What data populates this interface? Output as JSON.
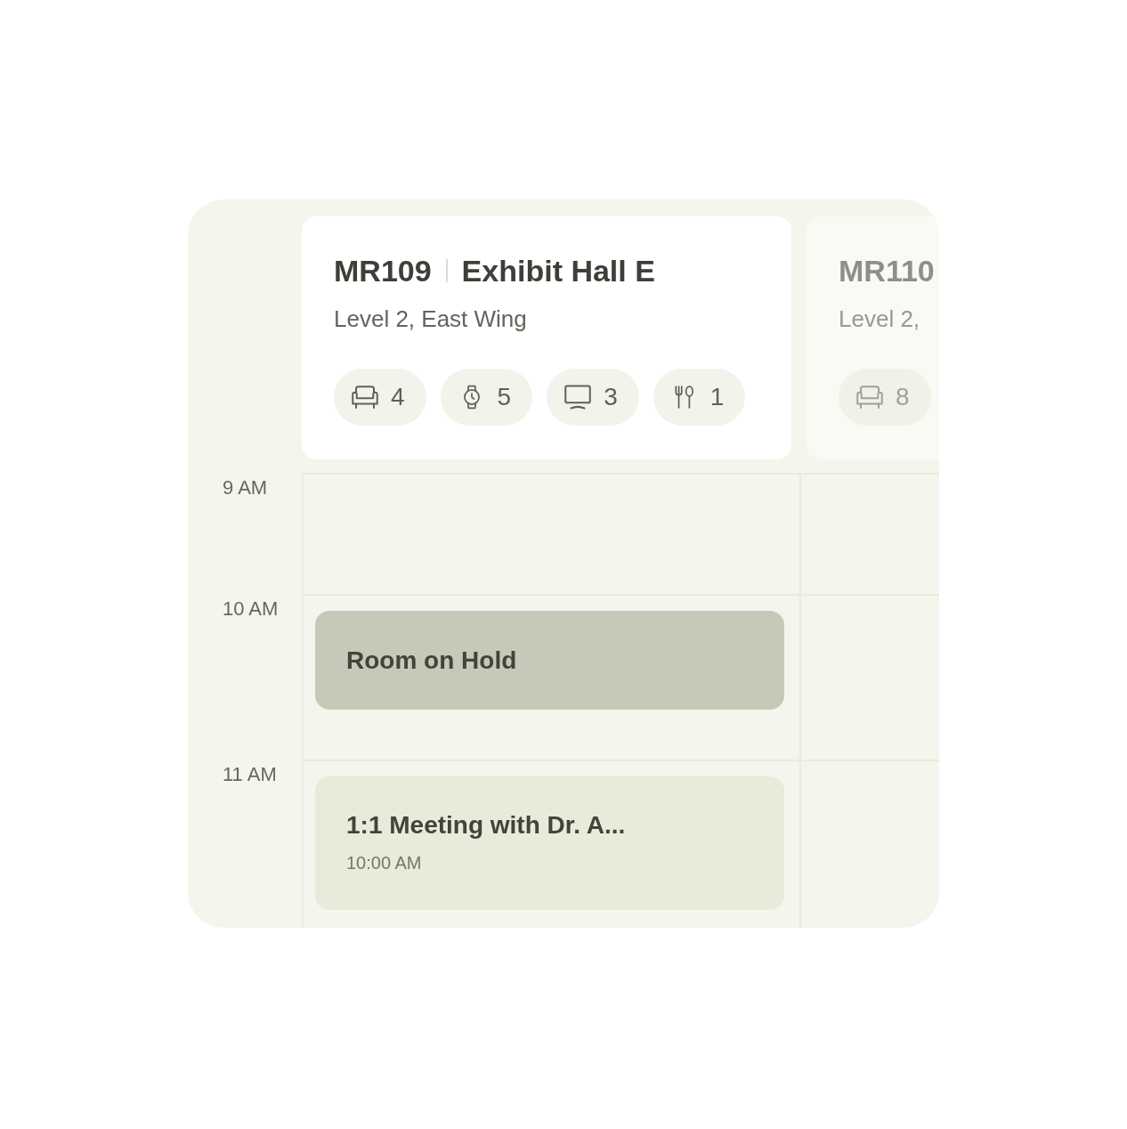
{
  "rooms": [
    {
      "code": "MR109",
      "name": "Exhibit Hall E",
      "location": "Level 2, East Wing",
      "dimmed": false,
      "amenities": [
        {
          "kind": "seating",
          "count": "4"
        },
        {
          "kind": "watch",
          "count": "5"
        },
        {
          "kind": "display",
          "count": "3"
        },
        {
          "kind": "catering",
          "count": "1"
        }
      ]
    },
    {
      "code": "MR110",
      "location": "Level 2,",
      "dimmed": true,
      "amenities": [
        {
          "kind": "seating",
          "count": "8"
        }
      ]
    }
  ],
  "hours": [
    {
      "label": "9 AM"
    },
    {
      "label": "10 AM",
      "events": [
        {
          "kind": "hold",
          "title": "Room on Hold"
        }
      ]
    },
    {
      "label": "11 AM",
      "events": [
        {
          "kind": "meeting",
          "title": "1:1 Meeting with Dr. A...",
          "time": "10:00 AM"
        }
      ]
    }
  ]
}
